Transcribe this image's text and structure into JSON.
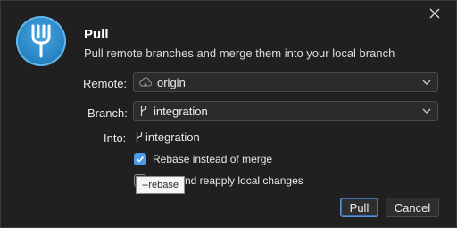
{
  "dialog": {
    "title": "Pull",
    "subtitle": "Pull remote branches and merge them into your local branch",
    "close_icon": "close-icon",
    "logo_icon": "fork-icon"
  },
  "form": {
    "remote": {
      "label": "Remote:",
      "value": "origin",
      "icon": "cloud-icon"
    },
    "branch": {
      "label": "Branch:",
      "value": "integration",
      "icon": "branch-icon"
    },
    "into": {
      "label": "Into:",
      "value": "integration",
      "icon": "branch-icon"
    }
  },
  "options": {
    "rebase": {
      "label": "Rebase instead of merge",
      "checked": true
    },
    "stash": {
      "label": "nd reapply local changes",
      "checked": false
    }
  },
  "tooltip": {
    "text": "--rebase"
  },
  "buttons": {
    "pull": "Pull",
    "cancel": "Cancel"
  },
  "colors": {
    "accent": "#4c9be8",
    "background": "#202020"
  }
}
